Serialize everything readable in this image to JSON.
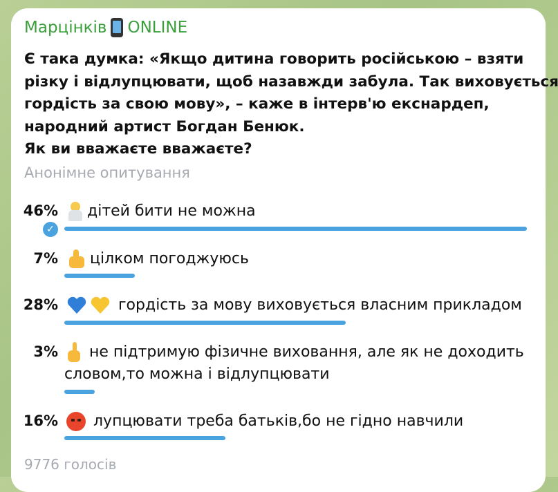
{
  "channel": {
    "name": "Марцінків",
    "status": "ONLINE",
    "name_icon": "mobile-phone-icon"
  },
  "message": {
    "lines": [
      "Є така думка: «Якщо дитина говорить російською – взяти",
      "різку і відлупцювати, щоб назавжди забула. Так виховується",
      "гордість за свою мову», – каже в інтерв'ю екснардеп,",
      "народний артист Богдан Бенюк.",
      "Як ви вважаєте вважаєте?"
    ]
  },
  "poll": {
    "type": "Анонімне опитування",
    "options": [
      {
        "percent": "46%",
        "percent_value": 46,
        "label": "дітей бити не можна",
        "emoji": "man-gesturing-no-icon",
        "selected": true
      },
      {
        "percent": "7%",
        "percent_value": 7,
        "label": "цілком погоджуюсь",
        "emoji": "thumbs-up-icon",
        "selected": false
      },
      {
        "percent": "28%",
        "percent_value": 28,
        "label": " гордість за мову виховується власним прикладом",
        "emoji": "blue-yellow-hearts-icon",
        "selected": false
      },
      {
        "percent": "3%",
        "percent_value": 3,
        "label_lines": [
          "не підтримую фізичне виховання, але як не доходить",
          "словом,то можна і відлупцювати"
        ],
        "emoji": "index-pointing-up-icon",
        "selected": false
      },
      {
        "percent": "16%",
        "percent_value": 16,
        "label": " лупцювати треба батьків,бо не гідно навчили",
        "emoji": "angry-face-icon",
        "selected": false
      }
    ],
    "votes": "9776 голосів"
  },
  "colors": {
    "accent": "#4aa3df",
    "channel_name": "#3a9f3a",
    "muted": "#a6aab0"
  }
}
